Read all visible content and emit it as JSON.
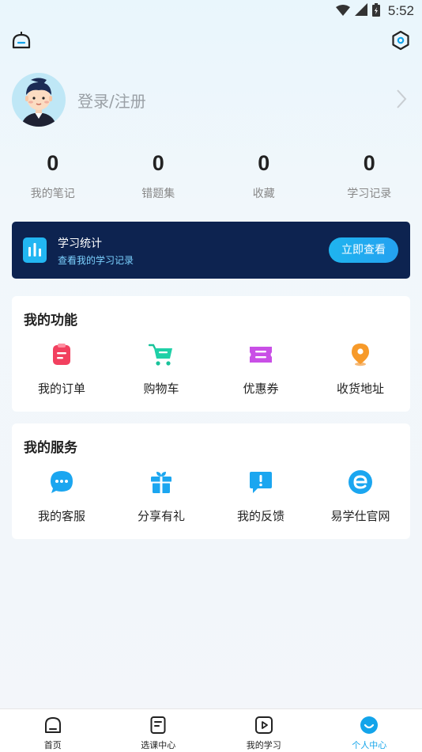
{
  "status_bar": {
    "time": "5:52"
  },
  "profile": {
    "login_label": "登录/注册"
  },
  "stats": [
    {
      "value": "0",
      "label": "我的笔记"
    },
    {
      "value": "0",
      "label": "错题集"
    },
    {
      "value": "0",
      "label": "收藏"
    },
    {
      "value": "0",
      "label": "学习记录"
    }
  ],
  "study_banner": {
    "title": "学习统计",
    "subtitle": "查看我的学习记录",
    "button": "立即查看"
  },
  "my_functions": {
    "title": "我的功能",
    "items": [
      {
        "label": "我的订单",
        "icon": "order-icon"
      },
      {
        "label": "购物车",
        "icon": "cart-icon"
      },
      {
        "label": "优惠券",
        "icon": "coupon-icon"
      },
      {
        "label": "收货地址",
        "icon": "location-icon"
      }
    ]
  },
  "my_services": {
    "title": "我的服务",
    "items": [
      {
        "label": "我的客服",
        "icon": "chat-icon"
      },
      {
        "label": "分享有礼",
        "icon": "gift-icon"
      },
      {
        "label": "我的反馈",
        "icon": "feedback-icon"
      },
      {
        "label": "易学仕官网",
        "icon": "website-icon"
      }
    ]
  },
  "tabs": [
    {
      "label": "首页",
      "icon": "home-icon"
    },
    {
      "label": "选课中心",
      "icon": "course-icon"
    },
    {
      "label": "我的学习",
      "icon": "play-icon"
    },
    {
      "label": "个人中心",
      "icon": "profile-icon",
      "active": true
    }
  ],
  "colors": {
    "accent": "#13a4ea",
    "banner_bg": "#0d2350"
  }
}
